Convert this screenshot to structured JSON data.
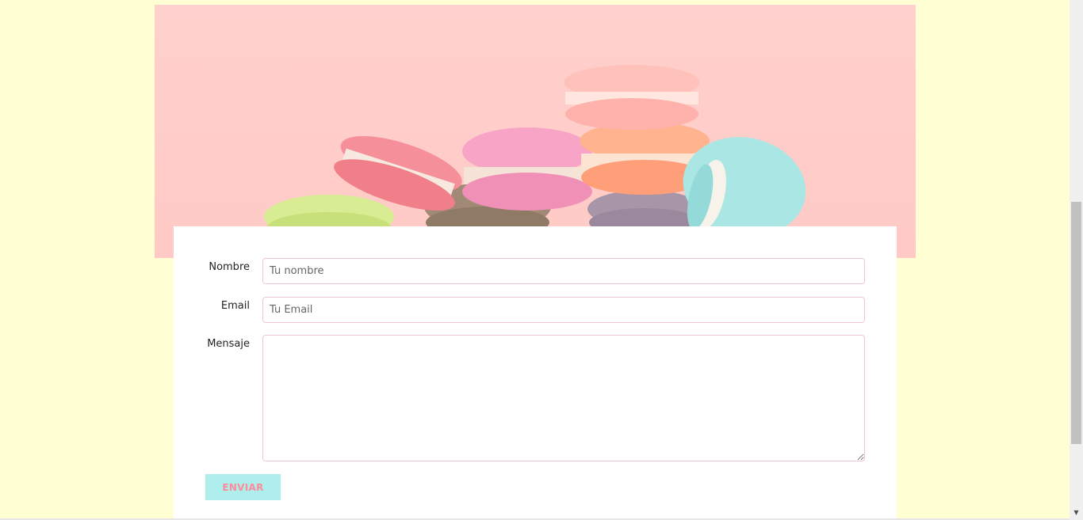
{
  "hero": {
    "image_alt": "macarons",
    "background_color": "#ffcbc8"
  },
  "form": {
    "name": {
      "label": "Nombre",
      "placeholder": "Tu nombre",
      "value": ""
    },
    "email": {
      "label": "Email",
      "placeholder": "Tu Email",
      "value": ""
    },
    "message": {
      "label": "Mensaje",
      "placeholder": "",
      "value": ""
    },
    "submit_label": "ENVIAR"
  },
  "colors": {
    "page_background": "#ffffd3",
    "field_border": "#f1c6cf",
    "button_background": "#aeeeed",
    "button_text": "#ff8c9a"
  },
  "icons": {
    "scroll_down": "chevron-down-icon"
  }
}
